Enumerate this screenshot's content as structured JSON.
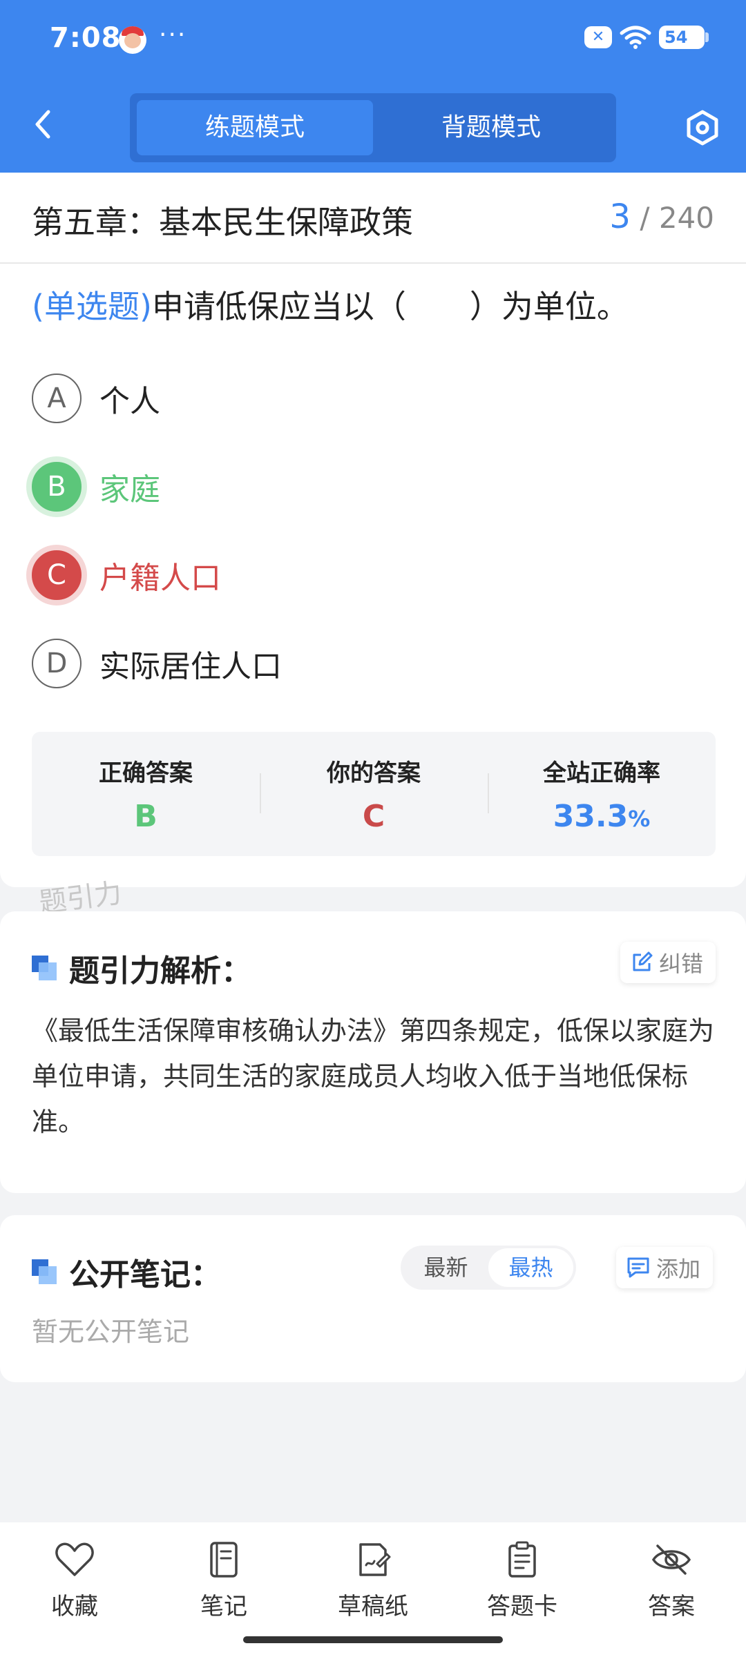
{
  "status_bar": {
    "time": "7:08",
    "dots": "···",
    "battery": "54"
  },
  "header": {
    "modes": [
      "练题模式",
      "背题模式"
    ],
    "active_mode": "练题模式"
  },
  "question_card": {
    "chapter": "第五章：基本民生保障政策",
    "current": "3",
    "total": "/ 240",
    "type": "(单选题)",
    "question": "申请低保应当以（　　）为单位。",
    "options": [
      {
        "letter": "A",
        "text": "个人",
        "state": "normal"
      },
      {
        "letter": "B",
        "text": "家庭",
        "state": "correct"
      },
      {
        "letter": "C",
        "text": "户籍人口",
        "state": "wrong"
      },
      {
        "letter": "D",
        "text": "实际居住人口",
        "state": "normal"
      }
    ],
    "stats": {
      "correct_label": "正确答案",
      "correct_value": "B",
      "yours_label": "你的答案",
      "yours_value": "C",
      "rate_label": "全站正确率",
      "rate_value": "33.3",
      "rate_unit": "%"
    },
    "watermark": "题引力"
  },
  "analysis": {
    "title": "题引力解析：",
    "report_label": "纠错",
    "text": "《最低生活保障审核确认办法》第四条规定，低保以家庭为单位申请，共同生活的家庭成员人均收入低于当地低保标准。"
  },
  "notes": {
    "title": "公开笔记：",
    "sort_options": [
      "最新",
      "最热"
    ],
    "active_sort": "最热",
    "add_label": "添加",
    "empty_text": "暂无公开笔记"
  },
  "bottom_nav": {
    "items": [
      {
        "label": "收藏",
        "icon": "heart-icon"
      },
      {
        "label": "笔记",
        "icon": "notebook-icon"
      },
      {
        "label": "草稿纸",
        "icon": "draft-paper-icon"
      },
      {
        "label": "答题卡",
        "icon": "answer-sheet-icon"
      },
      {
        "label": "答案",
        "icon": "eye-off-icon"
      }
    ]
  },
  "colors": {
    "primary": "#3d86ef",
    "correct": "#5cc67a",
    "wrong": "#d44a4a"
  }
}
